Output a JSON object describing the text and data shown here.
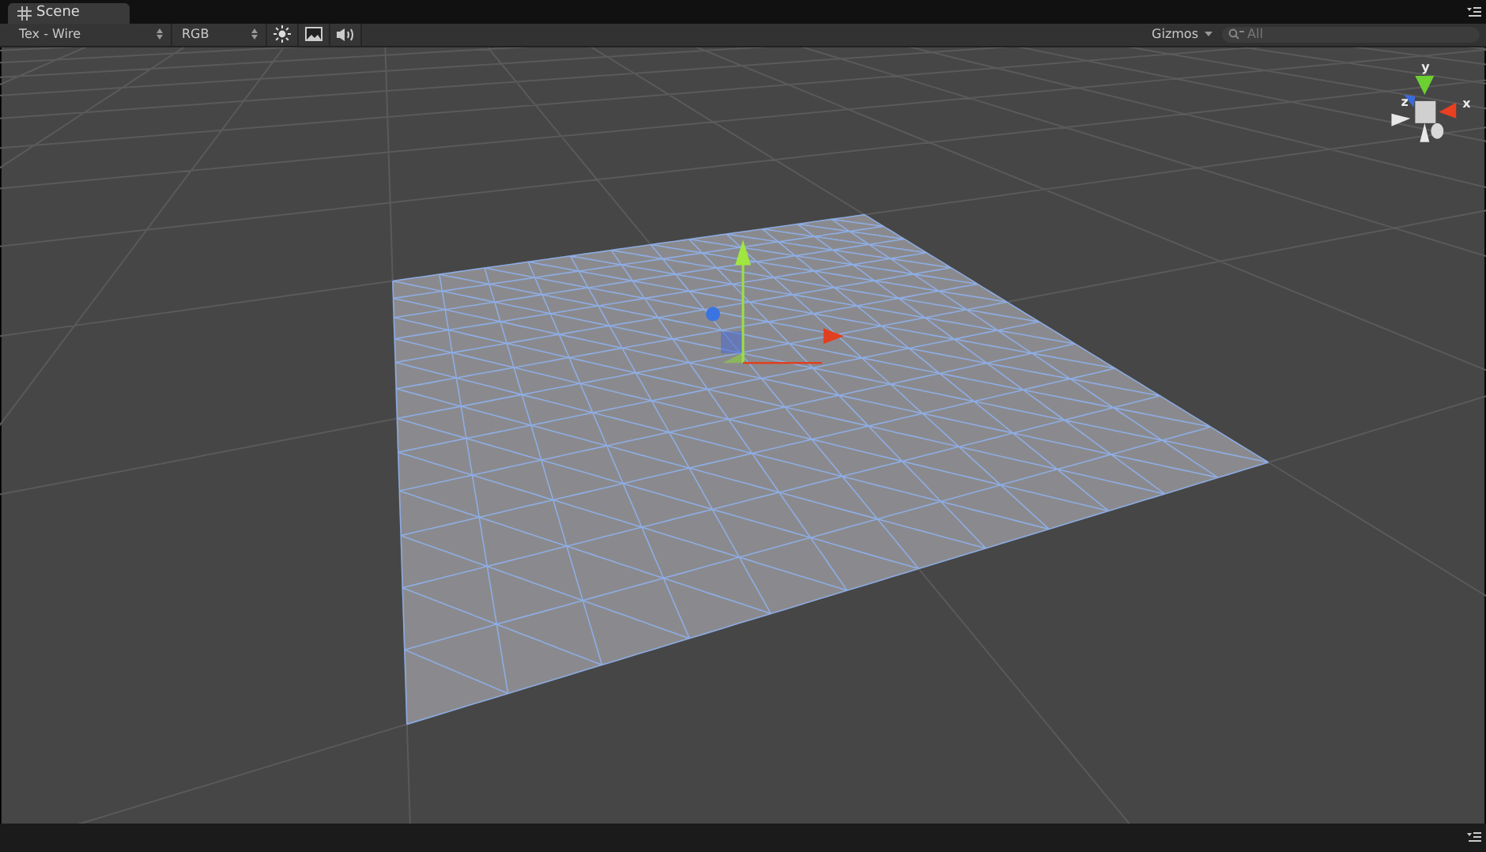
{
  "tab": {
    "title": "Scene",
    "selected": true
  },
  "toolbar": {
    "render_mode": "Tex - Wire",
    "color_mode": "RGB",
    "gizmos": "Gizmos",
    "search": {
      "placeholder": "All"
    }
  },
  "orientation_gizmo": {
    "axes": [
      {
        "kind": "y",
        "label": "y"
      },
      {
        "kind": "z",
        "label": "z"
      },
      {
        "kind": "x",
        "label": "x"
      }
    ]
  }
}
